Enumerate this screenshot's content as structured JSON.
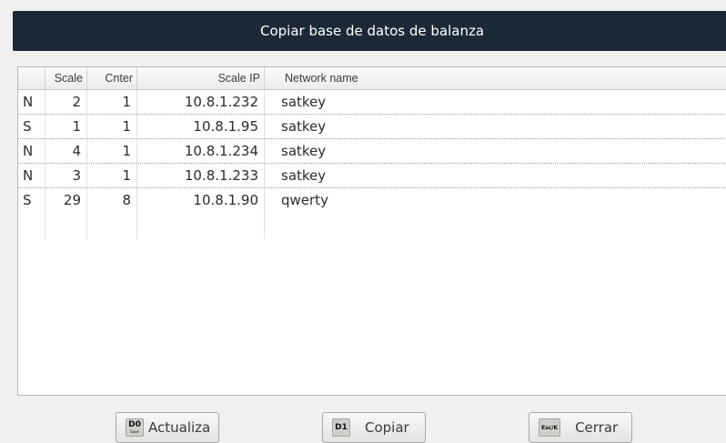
{
  "window": {
    "title": "Copiar base de datos de balanza"
  },
  "table": {
    "headers": [
      "",
      "Scale",
      "Cnter",
      "Scale IP",
      "Network name"
    ],
    "rows": [
      [
        "N",
        "2",
        "1",
        "10.8.1.232",
        "satkey"
      ],
      [
        "S",
        "1",
        "1",
        "10.8.1.95",
        "satkey"
      ],
      [
        "N",
        "4",
        "1",
        "10.8.1.234",
        "satkey"
      ],
      [
        "N",
        "3",
        "1",
        "10.8.1.233",
        "satkey"
      ],
      [
        "S",
        "29",
        "8",
        "10.8.1.90",
        "qwerty"
      ]
    ]
  },
  "buttons": {
    "refresh": {
      "key": "D0",
      "key_sub": "Save",
      "label": "Actualiza"
    },
    "copy": {
      "key": "D1",
      "label": "Copiar"
    },
    "close": {
      "key": "Esc/K",
      "label": "Cerrar"
    }
  },
  "colors": {
    "title_bar": "#1b2937",
    "background": "#f1f0ef",
    "table_background": "#ffffff"
  }
}
